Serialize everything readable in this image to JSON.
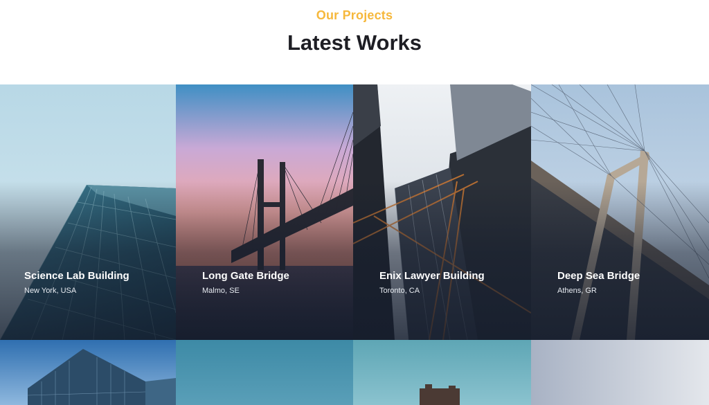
{
  "section": {
    "eyebrow": "Our Projects",
    "heading": "Latest Works"
  },
  "colors": {
    "accent": "#f6b83c",
    "heading": "#1e1e24"
  },
  "projects": [
    {
      "title": "Science Lab Building",
      "location": "New York, USA"
    },
    {
      "title": "Long Gate Bridge",
      "location": "Malmo, SE"
    },
    {
      "title": "Enix Lawyer Building",
      "location": "Toronto, CA"
    },
    {
      "title": "Deep Sea Bridge",
      "location": "Athens, GR"
    }
  ]
}
